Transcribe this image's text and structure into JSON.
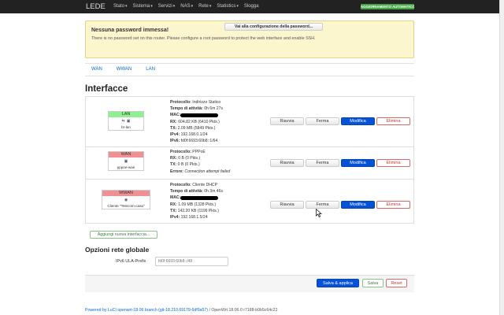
{
  "navbar": {
    "brand": "LEDE",
    "menu": [
      "Stato",
      "Sistema",
      "Servizi",
      "NAS",
      "Rete",
      "Statistics",
      "Slogga"
    ],
    "menu_dropdowns": [
      true,
      true,
      true,
      true,
      true,
      true,
      false
    ],
    "autorefresh": "AGGIORNAMENTO AUTOMATICO ACCESO",
    "accent_color": "#46a546"
  },
  "alert": {
    "title": "Nessuna password immessa!",
    "message": "There is no password set on this router. Please configure a root password to protect the web interface and enable SSH.",
    "button": "Vai alla configurazione della password..."
  },
  "tabs": [
    "WAN",
    "WWAN",
    "LAN"
  ],
  "section_title": "Interfacce",
  "interfaces": [
    {
      "name": "LAN",
      "header_color": "#90f090",
      "device": "br-lan",
      "icons": [
        "bridge-icon",
        "ethernet-icon"
      ],
      "lines": [
        {
          "label": "Protocollo:",
          "value": " Indirizzo Statico"
        },
        {
          "label": "Tempo di attività:",
          "value": " 0h 6m 27s"
        },
        {
          "label": "MAC:",
          "value": "",
          "redacted": true
        },
        {
          "label": "RX:",
          "value": " 604.82 KB (6410 Pkts.)"
        },
        {
          "label": "TX:",
          "value": " 2.09 MB (5849 Pkts.)"
        },
        {
          "label": "IPv4:",
          "value": " 192.168.0.1/24"
        },
        {
          "label": "IPv6:",
          "value": " fd0f:6693:60b8::1/64"
        }
      ]
    },
    {
      "name": "WAN",
      "header_color": "#f09090",
      "device": "pppoe-wan",
      "icons": [
        "ethernet-icon"
      ],
      "lines": [
        {
          "label": "Protocollo:",
          "value": " PPPoE"
        },
        {
          "label": "RX:",
          "value": " 0 B (0 Pkts.)"
        },
        {
          "label": "TX:",
          "value": " 0 B (0 Pkts.)"
        },
        {
          "label": "Errore:",
          "value": " Connection attempt failed",
          "italic": true
        }
      ]
    },
    {
      "name": "WWAN",
      "header_color": "#f09090",
      "device": "Cliente \"Telecom-casa\"",
      "icons": [
        "wifi-icon"
      ],
      "lines": [
        {
          "label": "Protocollo:",
          "value": " Cliente DHCP"
        },
        {
          "label": "Tempo di attività:",
          "value": " 0h 3m 46s"
        },
        {
          "label": "MAC:",
          "value": "",
          "redacted": true
        },
        {
          "label": "RX:",
          "value": " 1.09 MB (1328 Pkts.)"
        },
        {
          "label": "TX:",
          "value": " 142.20 KB (1199 Pkts.)"
        },
        {
          "label": "IPv4:",
          "value": " 192.168.1.5/24"
        }
      ]
    }
  ],
  "row_buttons": {
    "reload": "Riavvia",
    "stop": "Ferma",
    "edit": "Modifica",
    "delete": "Elimina"
  },
  "add_interface": "Aggiungi nuova interfaccia...",
  "global_options": {
    "title": "Opzioni rete globale",
    "ula_label": "IPv6 ULA-Prefix",
    "ula_placeholder": "fd0f:6693:60b8::/48"
  },
  "actions": {
    "save_apply": "Salva & applica",
    "save": "Salva",
    "reset": "Reset"
  },
  "footer": {
    "link": "Powered by LuCI openwrt-18.06 branch (git-18.210.69179-6df9a57)",
    "text": " / OpenWrt 18.06.0 r7188-b0b5c64c22"
  }
}
